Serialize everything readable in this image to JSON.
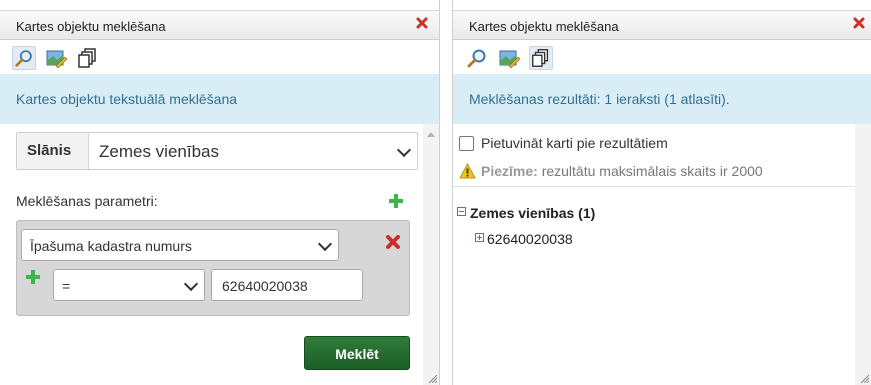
{
  "left_panel": {
    "title": "Kartes objektu meklēšana",
    "info": "Kartes objektu tekstuālā meklēšana",
    "layer": {
      "label": "Slānis",
      "value": "Zemes vienības"
    },
    "params_label": "Meklēšanas parametri:",
    "param": {
      "field_value": "Īpašuma kadastra numurs",
      "operator_value": "=",
      "input_value": "62640020038"
    },
    "search_button": "Meklēt"
  },
  "right_panel": {
    "title": "Kartes objektu meklēšana",
    "info": "Meklēšanas rezultāti: 1 ieraksti (1 atlasīti).",
    "zoom_checkbox_label": "Pietuvināt karti pie rezultātiem",
    "note_label": "Piezīme:",
    "note_text": " rezultātu maksimālais skaits ir 2000",
    "tree": {
      "root_label": "Zemes vienības (1)",
      "child_label": "62640020038"
    }
  },
  "icons": {
    "close": "close-icon",
    "search_tool": "search-icon",
    "map_tool": "map-edit-icon",
    "results_tool": "pages-icon",
    "add": "plus-icon",
    "remove": "red-x-icon",
    "warning": "warning-icon"
  },
  "colors": {
    "info_bg": "#d9edf7",
    "info_text": "#31708f",
    "search_button": "#1d5d27",
    "close_red": "#c9302c",
    "add_green": "#3cb54a"
  }
}
